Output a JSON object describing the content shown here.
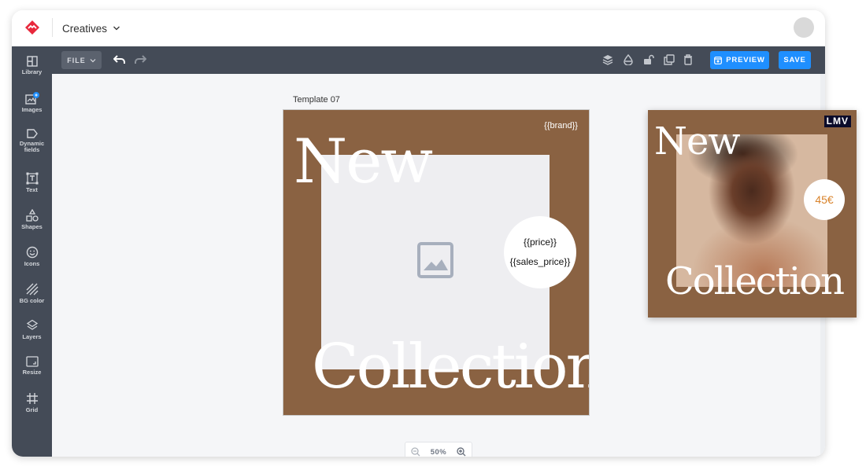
{
  "header": {
    "workspace_label": "Creatives"
  },
  "toolbar": {
    "file_label": "FILE",
    "preview_label": "PREVIEW",
    "save_label": "SAVE"
  },
  "sidebar": {
    "items": [
      {
        "label": "Library",
        "icon": "library-icon"
      },
      {
        "label": "Images",
        "icon": "images-icon"
      },
      {
        "label": "Dynamic fields",
        "icon": "tag-icon"
      },
      {
        "label": "Text",
        "icon": "text-icon"
      },
      {
        "label": "Shapes",
        "icon": "shapes-icon"
      },
      {
        "label": "Icons",
        "icon": "smiley-icon"
      },
      {
        "label": "BG color",
        "icon": "bg-color-icon"
      },
      {
        "label": "Layers",
        "icon": "layers-icon"
      },
      {
        "label": "Resize",
        "icon": "resize-icon"
      },
      {
        "label": "Grid",
        "icon": "grid-icon"
      }
    ]
  },
  "canvas": {
    "template_title": "Template 07",
    "brand_placeholder": "{{brand}}",
    "headline_top": "New",
    "headline_bottom": "Collection",
    "price_placeholder": "{{price}}",
    "sales_price_placeholder": "{{sales_price}}",
    "zoom_level": "50%"
  },
  "preview_card": {
    "brand": "LMV",
    "headline_top": "New",
    "headline_bottom": "Collection",
    "price": "45€"
  },
  "colors": {
    "accent": "#1f8fff",
    "toolbar_bg": "#444b57",
    "artboard_bg": "#8a6242",
    "logo_red": "#e8283c",
    "price_orange": "#d9832b"
  }
}
